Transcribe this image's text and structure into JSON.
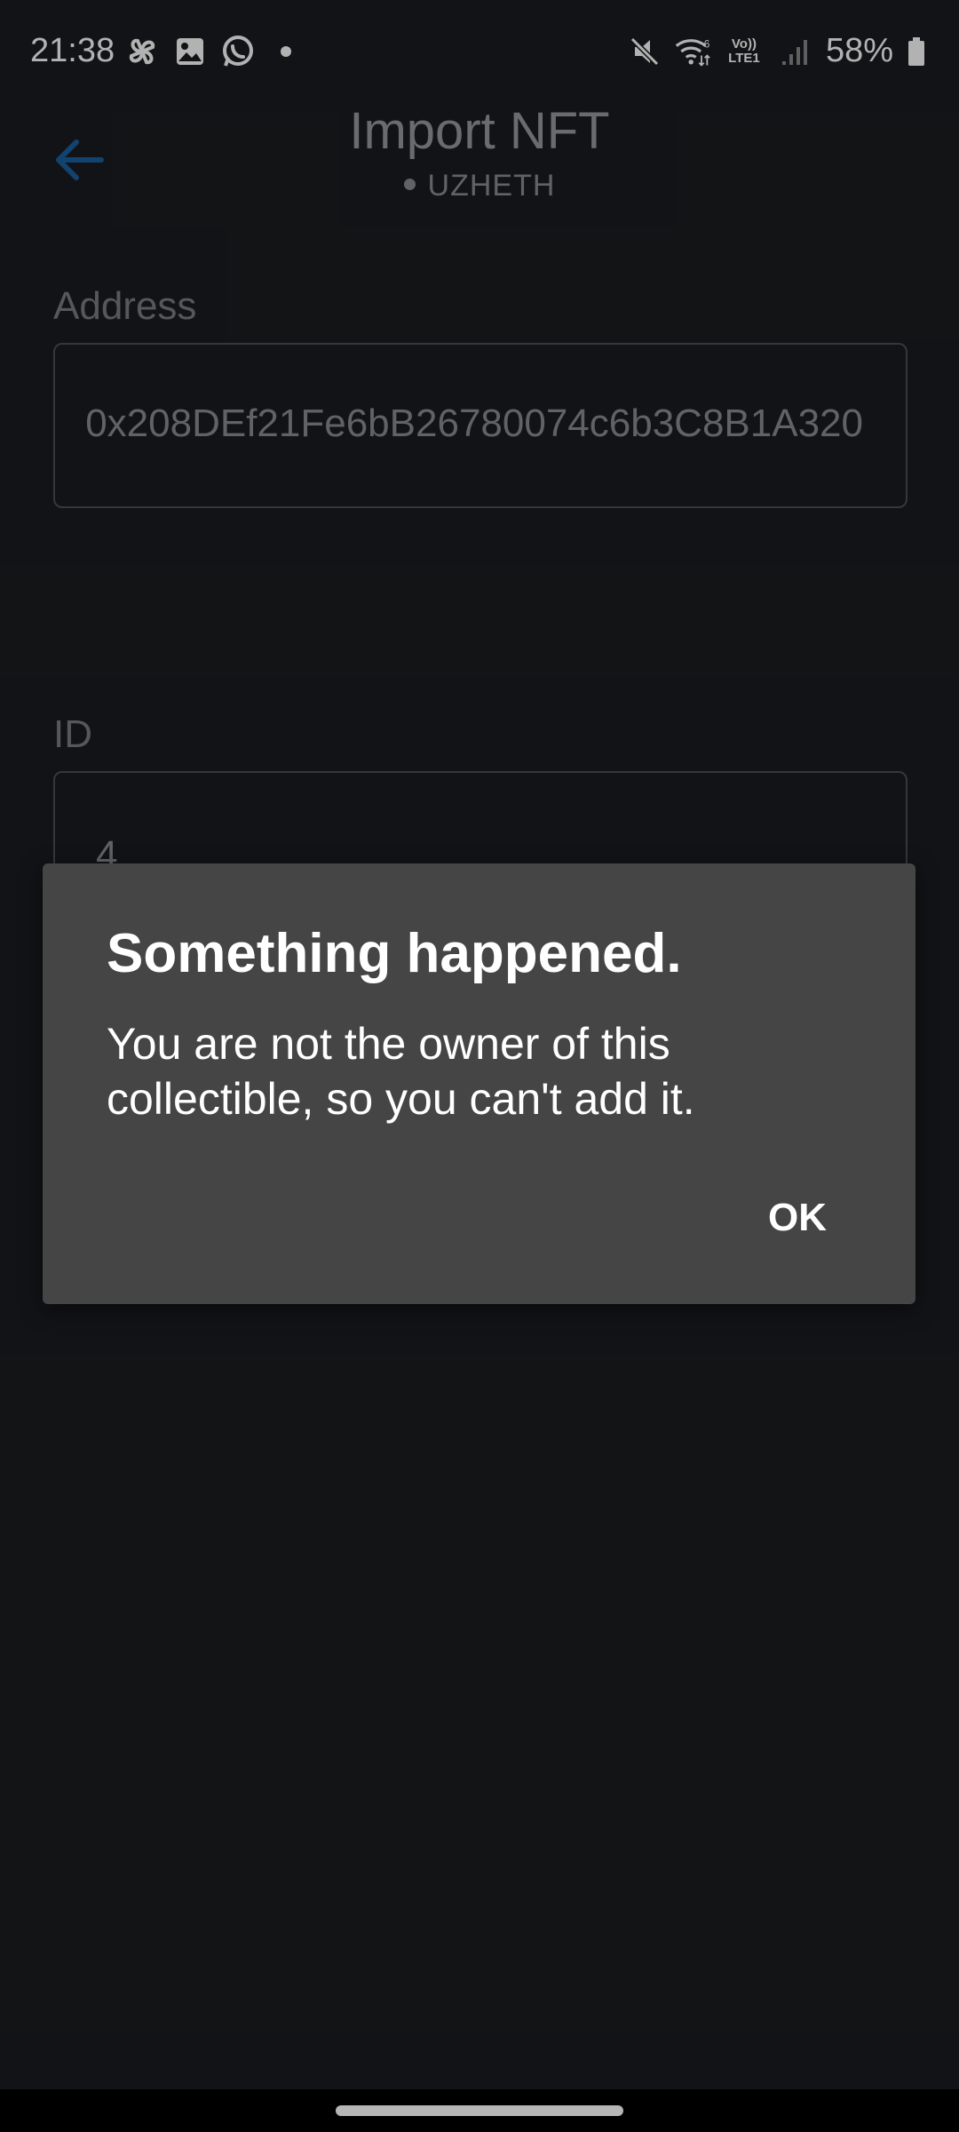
{
  "status_bar": {
    "time": "21:38",
    "left_icons": [
      "pinwheel-icon",
      "gallery-icon",
      "whatsapp-icon",
      "dot-icon"
    ],
    "right_icons": [
      "mute-icon",
      "wifi-icon",
      "volte-icon",
      "signal-icon",
      "battery-icon"
    ],
    "lte_label": "Vo))\nLTE1",
    "battery": "58%"
  },
  "header": {
    "title": "Import NFT",
    "network": "UZHETH",
    "accent_color": "#1a5f9e"
  },
  "form": {
    "address_label": "Address",
    "address_value": "0x208DEf21Fe6bB26780074c6b3C8B1A320",
    "id_label": "ID",
    "id_value": "4"
  },
  "dialog": {
    "title": "Something happened.",
    "message": "You are not the owner of this collectible, so you can't add it.",
    "ok_label": "OK"
  }
}
